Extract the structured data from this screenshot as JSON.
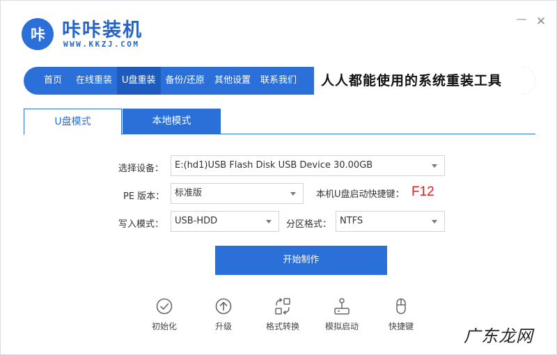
{
  "app": {
    "logo_mark": "咔",
    "name": "咔咔装机",
    "url": "WWW.KKZJ.COM"
  },
  "window_controls": {
    "minimize": "—",
    "close": "✕"
  },
  "nav": {
    "items": [
      "首页",
      "在线重装",
      "U盘重装",
      "备份/还原",
      "其他设置",
      "联系我们"
    ],
    "active": "U盘重装",
    "slogan": "人人都能使用的系统重装工具"
  },
  "tabs": {
    "u_mode": "U盘模式",
    "local_mode": "本地模式",
    "active": "U盘模式"
  },
  "form": {
    "device_label": "选择设备：",
    "device_value": "E:(hd1)USB Flash Disk USB Device 30.00GB",
    "pe_label": "PE 版本：",
    "pe_value": "标准版",
    "hotkey_label": "本机U盘启动快捷键：",
    "hotkey_value": "F12",
    "write_label": "写入模式：",
    "write_value": "USB-HDD",
    "partition_label": "分区格式：",
    "partition_value": "NTFS"
  },
  "start_button": "开始制作",
  "tools": [
    {
      "label": "初始化",
      "icon": "check-circle-icon"
    },
    {
      "label": "升级",
      "icon": "arrow-up-circle-icon"
    },
    {
      "label": "格式转换",
      "icon": "convert-icon"
    },
    {
      "label": "模拟启动",
      "icon": "joystick-icon"
    },
    {
      "label": "快捷键",
      "icon": "mouse-icon"
    }
  ],
  "watermark": "广东龙网",
  "colors": {
    "primary": "#2b6fd8",
    "hotkey": "#e02020",
    "nav_active": "#1e5bbf"
  }
}
